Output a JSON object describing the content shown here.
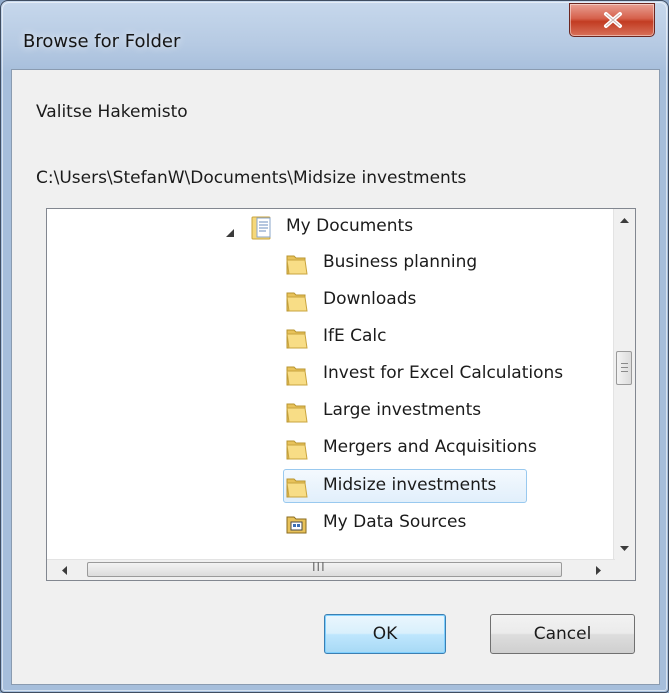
{
  "window": {
    "title": "Browse for Folder",
    "close_symbol": "X"
  },
  "dialog": {
    "instruction": "Valitse Hakemisto",
    "current_path": "C:\\Users\\StefanW\\Documents\\Midsize investments"
  },
  "tree": {
    "root": {
      "label": "My Documents",
      "icon": "documents-folder-icon",
      "expanded": true
    },
    "items": [
      {
        "label": "Business planning",
        "icon": "folder-icon"
      },
      {
        "label": "Downloads",
        "icon": "folder-icon"
      },
      {
        "label": "IfE Calc",
        "icon": "folder-icon"
      },
      {
        "label": "Invest for Excel Calculations",
        "icon": "folder-icon"
      },
      {
        "label": "Large investments",
        "icon": "folder-icon"
      },
      {
        "label": "Mergers and Acquisitions",
        "icon": "folder-icon"
      },
      {
        "label": "Midsize investments",
        "icon": "folder-icon",
        "selected": true
      },
      {
        "label": "My Data Sources",
        "icon": "data-sources-folder-icon"
      }
    ],
    "hscroll_grip": "III"
  },
  "buttons": {
    "ok_label": "OK",
    "cancel_label": "Cancel"
  },
  "colors": {
    "title_bar": "#b6cae3",
    "close_button": "#c94a32",
    "selection_border": "#99c9ef",
    "selection_fill": "#e1effb",
    "default_button_border": "#3c7fb1"
  }
}
